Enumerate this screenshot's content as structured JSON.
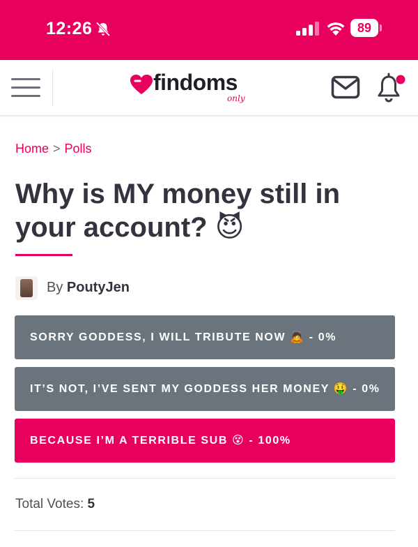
{
  "status_bar": {
    "time": "12:26",
    "battery": "89",
    "background_color": "#e8005f"
  },
  "header": {
    "logo_text": "findoms",
    "logo_subtext": "only"
  },
  "breadcrumb": {
    "home": "Home",
    "separator": ">",
    "current": "Polls"
  },
  "poll": {
    "title": "Why is MY money still in your account? 😈",
    "by_label": "By",
    "author": "PoutyJen",
    "options": [
      {
        "label": "SORRY GODDESS, I WILL TRIBUTE NOW 🙇 - 0%",
        "percent": 0,
        "selected": false
      },
      {
        "label": "IT’S NOT, I’VE SENT MY GODDESS HER MONEY 🤑 - 0%",
        "percent": 0,
        "selected": false
      },
      {
        "label": "BECAUSE I’M A TERRIBLE SUB 😵 - 100%",
        "percent": 100,
        "selected": true
      }
    ],
    "total_votes_label": "Total Votes:",
    "total_votes": "5"
  },
  "colors": {
    "accent": "#e8005f",
    "option_grey": "#6b737c",
    "text_dark": "#33333f"
  },
  "icons": [
    "bell-slash-icon",
    "signal-icon",
    "wifi-icon",
    "battery-icon",
    "hamburger-menu-icon",
    "heart-logo-icon",
    "mail-icon",
    "bell-icon"
  ]
}
